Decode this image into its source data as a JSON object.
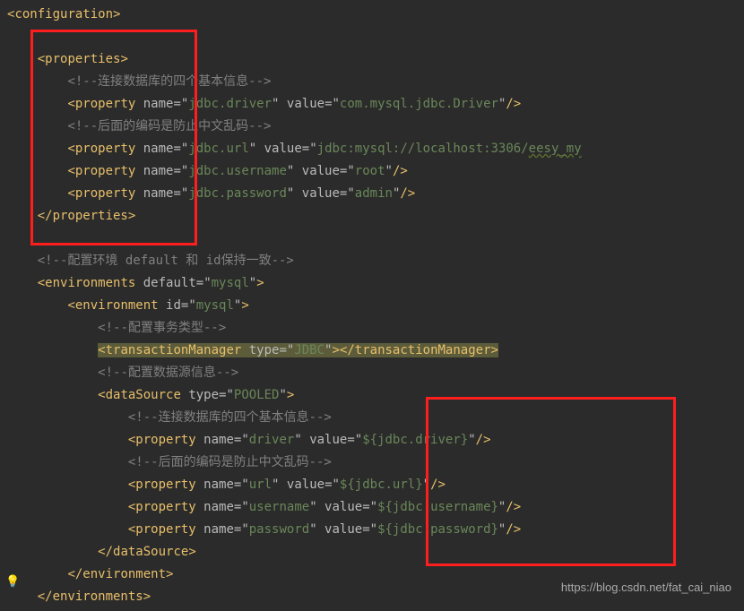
{
  "lines": [
    {
      "indent": 0,
      "parts": [
        {
          "t": "punct",
          "v": "<"
        },
        {
          "t": "tag",
          "v": "configuration"
        },
        {
          "t": "punct",
          "v": ">"
        }
      ]
    },
    {
      "indent": 0,
      "parts": []
    },
    {
      "indent": 1,
      "parts": [
        {
          "t": "punct",
          "v": "<"
        },
        {
          "t": "tag",
          "v": "properties"
        },
        {
          "t": "punct",
          "v": ">"
        }
      ]
    },
    {
      "indent": 2,
      "parts": [
        {
          "t": "comment",
          "v": "<!--连接数据库的四个基本信息-->"
        }
      ]
    },
    {
      "indent": 2,
      "parts": [
        {
          "t": "punct",
          "v": "<"
        },
        {
          "t": "tag",
          "v": "property"
        },
        {
          "t": "plain",
          "v": " "
        },
        {
          "t": "attr-name",
          "v": "name"
        },
        {
          "t": "attr-eq",
          "v": "=\""
        },
        {
          "t": "attr-val",
          "v": "jdbc.driver"
        },
        {
          "t": "attr-eq",
          "v": "\" "
        },
        {
          "t": "attr-name",
          "v": "value"
        },
        {
          "t": "attr-eq",
          "v": "=\""
        },
        {
          "t": "attr-val",
          "v": "com.mysql.jdbc.Driver"
        },
        {
          "t": "attr-eq",
          "v": "\""
        },
        {
          "t": "punct",
          "v": "/>"
        }
      ]
    },
    {
      "indent": 2,
      "parts": [
        {
          "t": "comment",
          "v": "<!--后面的编码是防止中文乱码-->"
        }
      ]
    },
    {
      "indent": 2,
      "parts": [
        {
          "t": "punct",
          "v": "<"
        },
        {
          "t": "tag",
          "v": "property"
        },
        {
          "t": "plain",
          "v": " "
        },
        {
          "t": "attr-name",
          "v": "name"
        },
        {
          "t": "attr-eq",
          "v": "=\""
        },
        {
          "t": "attr-val",
          "v": "jdbc.url"
        },
        {
          "t": "attr-eq",
          "v": "\" "
        },
        {
          "t": "attr-name",
          "v": "value"
        },
        {
          "t": "attr-eq",
          "v": "=\""
        },
        {
          "t": "attr-val",
          "v": "jdbc:mysql://localhost:3306/"
        },
        {
          "t": "attr-val",
          "cls": "text-underline",
          "v": "eesy_my"
        }
      ]
    },
    {
      "indent": 2,
      "parts": [
        {
          "t": "punct",
          "v": "<"
        },
        {
          "t": "tag",
          "v": "property"
        },
        {
          "t": "plain",
          "v": " "
        },
        {
          "t": "attr-name",
          "v": "name"
        },
        {
          "t": "attr-eq",
          "v": "=\""
        },
        {
          "t": "attr-val",
          "v": "jdbc.username"
        },
        {
          "t": "attr-eq",
          "v": "\" "
        },
        {
          "t": "attr-name",
          "v": "value"
        },
        {
          "t": "attr-eq",
          "v": "=\""
        },
        {
          "t": "attr-val",
          "v": "root"
        },
        {
          "t": "attr-eq",
          "v": "\""
        },
        {
          "t": "punct",
          "v": "/>"
        }
      ]
    },
    {
      "indent": 2,
      "parts": [
        {
          "t": "punct",
          "v": "<"
        },
        {
          "t": "tag",
          "v": "property"
        },
        {
          "t": "plain",
          "v": " "
        },
        {
          "t": "attr-name",
          "v": "name"
        },
        {
          "t": "attr-eq",
          "v": "=\""
        },
        {
          "t": "attr-val",
          "v": "jdbc.password"
        },
        {
          "t": "attr-eq",
          "v": "\" "
        },
        {
          "t": "attr-name",
          "v": "value"
        },
        {
          "t": "attr-eq",
          "v": "=\""
        },
        {
          "t": "attr-val",
          "v": "admin"
        },
        {
          "t": "attr-eq",
          "v": "\""
        },
        {
          "t": "punct",
          "v": "/>"
        }
      ]
    },
    {
      "indent": 1,
      "parts": [
        {
          "t": "punct",
          "v": "</"
        },
        {
          "t": "tag",
          "v": "properties"
        },
        {
          "t": "punct",
          "v": ">"
        }
      ]
    },
    {
      "indent": 0,
      "parts": []
    },
    {
      "indent": 1,
      "parts": [
        {
          "t": "comment",
          "v": "<!--配置环境 default 和 id保持一致-->"
        }
      ]
    },
    {
      "indent": 1,
      "parts": [
        {
          "t": "punct",
          "v": "<"
        },
        {
          "t": "tag",
          "v": "environments"
        },
        {
          "t": "plain",
          "v": " "
        },
        {
          "t": "attr-name",
          "v": "default"
        },
        {
          "t": "attr-eq",
          "v": "=\""
        },
        {
          "t": "attr-val",
          "v": "mysql"
        },
        {
          "t": "attr-eq",
          "v": "\""
        },
        {
          "t": "punct",
          "v": ">"
        }
      ]
    },
    {
      "indent": 2,
      "parts": [
        {
          "t": "punct",
          "v": "<"
        },
        {
          "t": "tag",
          "v": "environment"
        },
        {
          "t": "plain",
          "v": " "
        },
        {
          "t": "attr-name",
          "v": "id"
        },
        {
          "t": "attr-eq",
          "v": "=\""
        },
        {
          "t": "attr-val",
          "v": "mysql"
        },
        {
          "t": "attr-eq",
          "v": "\""
        },
        {
          "t": "punct",
          "v": ">"
        }
      ]
    },
    {
      "indent": 3,
      "parts": [
        {
          "t": "comment",
          "v": "<!--配置事务类型-->"
        }
      ]
    },
    {
      "indent": 3,
      "highlight": true,
      "parts": [
        {
          "t": "punct",
          "v": "<"
        },
        {
          "t": "tag",
          "v": "transactionManager"
        },
        {
          "t": "plain",
          "v": " "
        },
        {
          "t": "attr-name",
          "v": "type"
        },
        {
          "t": "attr-eq",
          "v": "=\""
        },
        {
          "t": "attr-val",
          "v": "JDBC"
        },
        {
          "t": "attr-eq",
          "v": "\""
        },
        {
          "t": "punct",
          "v": "></"
        },
        {
          "t": "tag",
          "v": "transactionManager"
        },
        {
          "t": "punct",
          "v": ">"
        }
      ]
    },
    {
      "indent": 3,
      "parts": [
        {
          "t": "comment",
          "v": "<!--配置数据源信息-->"
        }
      ]
    },
    {
      "indent": 3,
      "parts": [
        {
          "t": "punct",
          "v": "<"
        },
        {
          "t": "tag",
          "v": "dataSource"
        },
        {
          "t": "plain",
          "v": " "
        },
        {
          "t": "attr-name",
          "v": "type"
        },
        {
          "t": "attr-eq",
          "v": "=\""
        },
        {
          "t": "attr-val",
          "v": "POOLED"
        },
        {
          "t": "attr-eq",
          "v": "\""
        },
        {
          "t": "punct",
          "v": ">"
        }
      ]
    },
    {
      "indent": 4,
      "parts": [
        {
          "t": "comment",
          "v": "<!--连接数据库的四个基本信息-->"
        }
      ]
    },
    {
      "indent": 4,
      "parts": [
        {
          "t": "punct",
          "v": "<"
        },
        {
          "t": "tag",
          "v": "property"
        },
        {
          "t": "plain",
          "v": " "
        },
        {
          "t": "attr-name",
          "v": "name"
        },
        {
          "t": "attr-eq",
          "v": "=\""
        },
        {
          "t": "attr-val",
          "v": "driver"
        },
        {
          "t": "attr-eq",
          "v": "\" "
        },
        {
          "t": "attr-name",
          "v": "value"
        },
        {
          "t": "attr-eq",
          "v": "=\""
        },
        {
          "t": "attr-val",
          "v": "${jdbc.driver}"
        },
        {
          "t": "attr-eq",
          "v": "\""
        },
        {
          "t": "punct",
          "v": "/>"
        }
      ]
    },
    {
      "indent": 4,
      "parts": [
        {
          "t": "comment",
          "v": "<!--后面的编码是防止中文乱码-->"
        }
      ]
    },
    {
      "indent": 4,
      "parts": [
        {
          "t": "punct",
          "v": "<"
        },
        {
          "t": "tag",
          "v": "property"
        },
        {
          "t": "plain",
          "v": " "
        },
        {
          "t": "attr-name",
          "v": "name"
        },
        {
          "t": "attr-eq",
          "v": "=\""
        },
        {
          "t": "attr-val",
          "v": "url"
        },
        {
          "t": "attr-eq",
          "v": "\" "
        },
        {
          "t": "attr-name",
          "v": "value"
        },
        {
          "t": "attr-eq",
          "v": "=\""
        },
        {
          "t": "attr-val",
          "v": "${jdbc.url}"
        },
        {
          "t": "attr-eq",
          "v": "\""
        },
        {
          "t": "punct",
          "v": "/>"
        }
      ]
    },
    {
      "indent": 4,
      "parts": [
        {
          "t": "punct",
          "v": "<"
        },
        {
          "t": "tag",
          "v": "property"
        },
        {
          "t": "plain",
          "v": " "
        },
        {
          "t": "attr-name",
          "v": "name"
        },
        {
          "t": "attr-eq",
          "v": "=\""
        },
        {
          "t": "attr-val",
          "v": "username"
        },
        {
          "t": "attr-eq",
          "v": "\" "
        },
        {
          "t": "attr-name",
          "v": "value"
        },
        {
          "t": "attr-eq",
          "v": "=\""
        },
        {
          "t": "attr-val",
          "v": "${jdbc.username}"
        },
        {
          "t": "attr-eq",
          "v": "\""
        },
        {
          "t": "punct",
          "v": "/>"
        }
      ]
    },
    {
      "indent": 4,
      "parts": [
        {
          "t": "punct",
          "v": "<"
        },
        {
          "t": "tag",
          "v": "property"
        },
        {
          "t": "plain",
          "v": " "
        },
        {
          "t": "attr-name",
          "v": "name"
        },
        {
          "t": "attr-eq",
          "v": "=\""
        },
        {
          "t": "attr-val",
          "v": "password"
        },
        {
          "t": "attr-eq",
          "v": "\" "
        },
        {
          "t": "attr-name",
          "v": "value"
        },
        {
          "t": "attr-eq",
          "v": "=\""
        },
        {
          "t": "attr-val",
          "v": "${jdbc.password}"
        },
        {
          "t": "attr-eq",
          "v": "\""
        },
        {
          "t": "punct",
          "v": "/>"
        }
      ]
    },
    {
      "indent": 3,
      "parts": [
        {
          "t": "punct",
          "v": "</"
        },
        {
          "t": "tag",
          "v": "dataSource"
        },
        {
          "t": "punct",
          "v": ">"
        }
      ]
    },
    {
      "indent": 2,
      "parts": [
        {
          "t": "punct",
          "v": "</"
        },
        {
          "t": "tag",
          "v": "environment"
        },
        {
          "t": "punct",
          "v": ">"
        }
      ]
    },
    {
      "indent": 1,
      "parts": [
        {
          "t": "punct",
          "v": "</"
        },
        {
          "t": "tag",
          "v": "environments"
        },
        {
          "t": "punct",
          "v": ">"
        }
      ]
    }
  ],
  "watermark": "https://blog.csdn.net/fat_cai_niao",
  "bulb": "💡",
  "indent_unit": "    "
}
